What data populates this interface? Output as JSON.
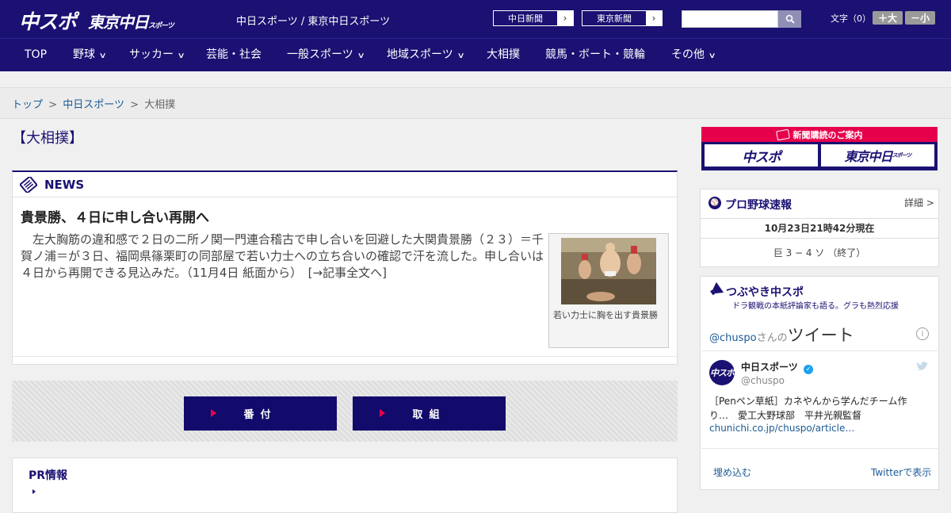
{
  "header": {
    "logo_main": "中スポ",
    "logo_sub": "東京中日",
    "logo_sub_small": "スポーツ",
    "site_titles": "中日スポーツ / 東京中日スポーツ",
    "paper_buttons": [
      "中日新聞",
      "東京新聞"
    ],
    "search_placeholder": "",
    "font_size_label": "文字（0）",
    "font_larger": "＋大",
    "font_smaller": "－小"
  },
  "nav": [
    {
      "label": "TOP",
      "dropdown": false
    },
    {
      "label": "野球",
      "dropdown": true
    },
    {
      "label": "サッカー",
      "dropdown": true
    },
    {
      "label": "芸能・社会",
      "dropdown": false
    },
    {
      "label": "一般スポーツ",
      "dropdown": true
    },
    {
      "label": "地域スポーツ",
      "dropdown": true
    },
    {
      "label": "大相撲",
      "dropdown": false
    },
    {
      "label": "競馬・ボート・競輪",
      "dropdown": false
    },
    {
      "label": "その他",
      "dropdown": true
    }
  ],
  "breadcrumb": {
    "items": [
      "トップ",
      "中日スポーツ",
      "大相撲"
    ],
    "sep": ">"
  },
  "page_title": "【大相撲】",
  "news": {
    "section_label": "NEWS",
    "headline": "貴景勝、４日に申し合い再開へ",
    "body": "　左大胸筋の違和感で２日の二所ノ関一門連合稽古で申し合いを回避した大関貴景勝（２３）＝千賀ノ浦＝が３日、福岡県篠栗町の同部屋で若い力士への立ち合いの確認で汗を流した。申し合いは４日から再開できる見込みだ。（11月4日 紙面から）　[→記事全文へ]",
    "photo_caption": "若い力士に胸を出す貴景勝"
  },
  "sumo_buttons": [
    "番付",
    "取組"
  ],
  "pr": {
    "label": "PR情報"
  },
  "sidebar": {
    "subscribe": {
      "title": "新聞購読のご案内",
      "logos": [
        "中スポ",
        "東京中日"
      ],
      "logo_small": "スポーツ"
    },
    "baseball": {
      "title": "プロ野球速報",
      "detail": "詳細 >",
      "timestamp": "10月23日21時42分現在",
      "score": "巨 3 − 4 ソ （終了）"
    },
    "tweets": {
      "title": "つぶやき中スポ",
      "subtitle": "ドラ観戦の本紙評論家も語る。グラも熱烈応援",
      "handle_prefix": "@chuspo",
      "handle_suffix": "さんの",
      "tweet_label": "ツイート",
      "user_name": "中日スポーツ",
      "user_handle": "@chuspo",
      "tweet_text": "［Penペン草紙］カネやんから学んだチーム作り…　愛工大野球部　平井光親監督",
      "tweet_link": "chunichi.co.jp/chuspo/article…",
      "embed": "埋め込む",
      "view_on": "Twitterで表示"
    }
  },
  "colors": {
    "brand_navy": "#1a1172",
    "button_navy": "#120b6b",
    "accent_red": "#e6004c",
    "link_blue": "#1a5a96"
  }
}
